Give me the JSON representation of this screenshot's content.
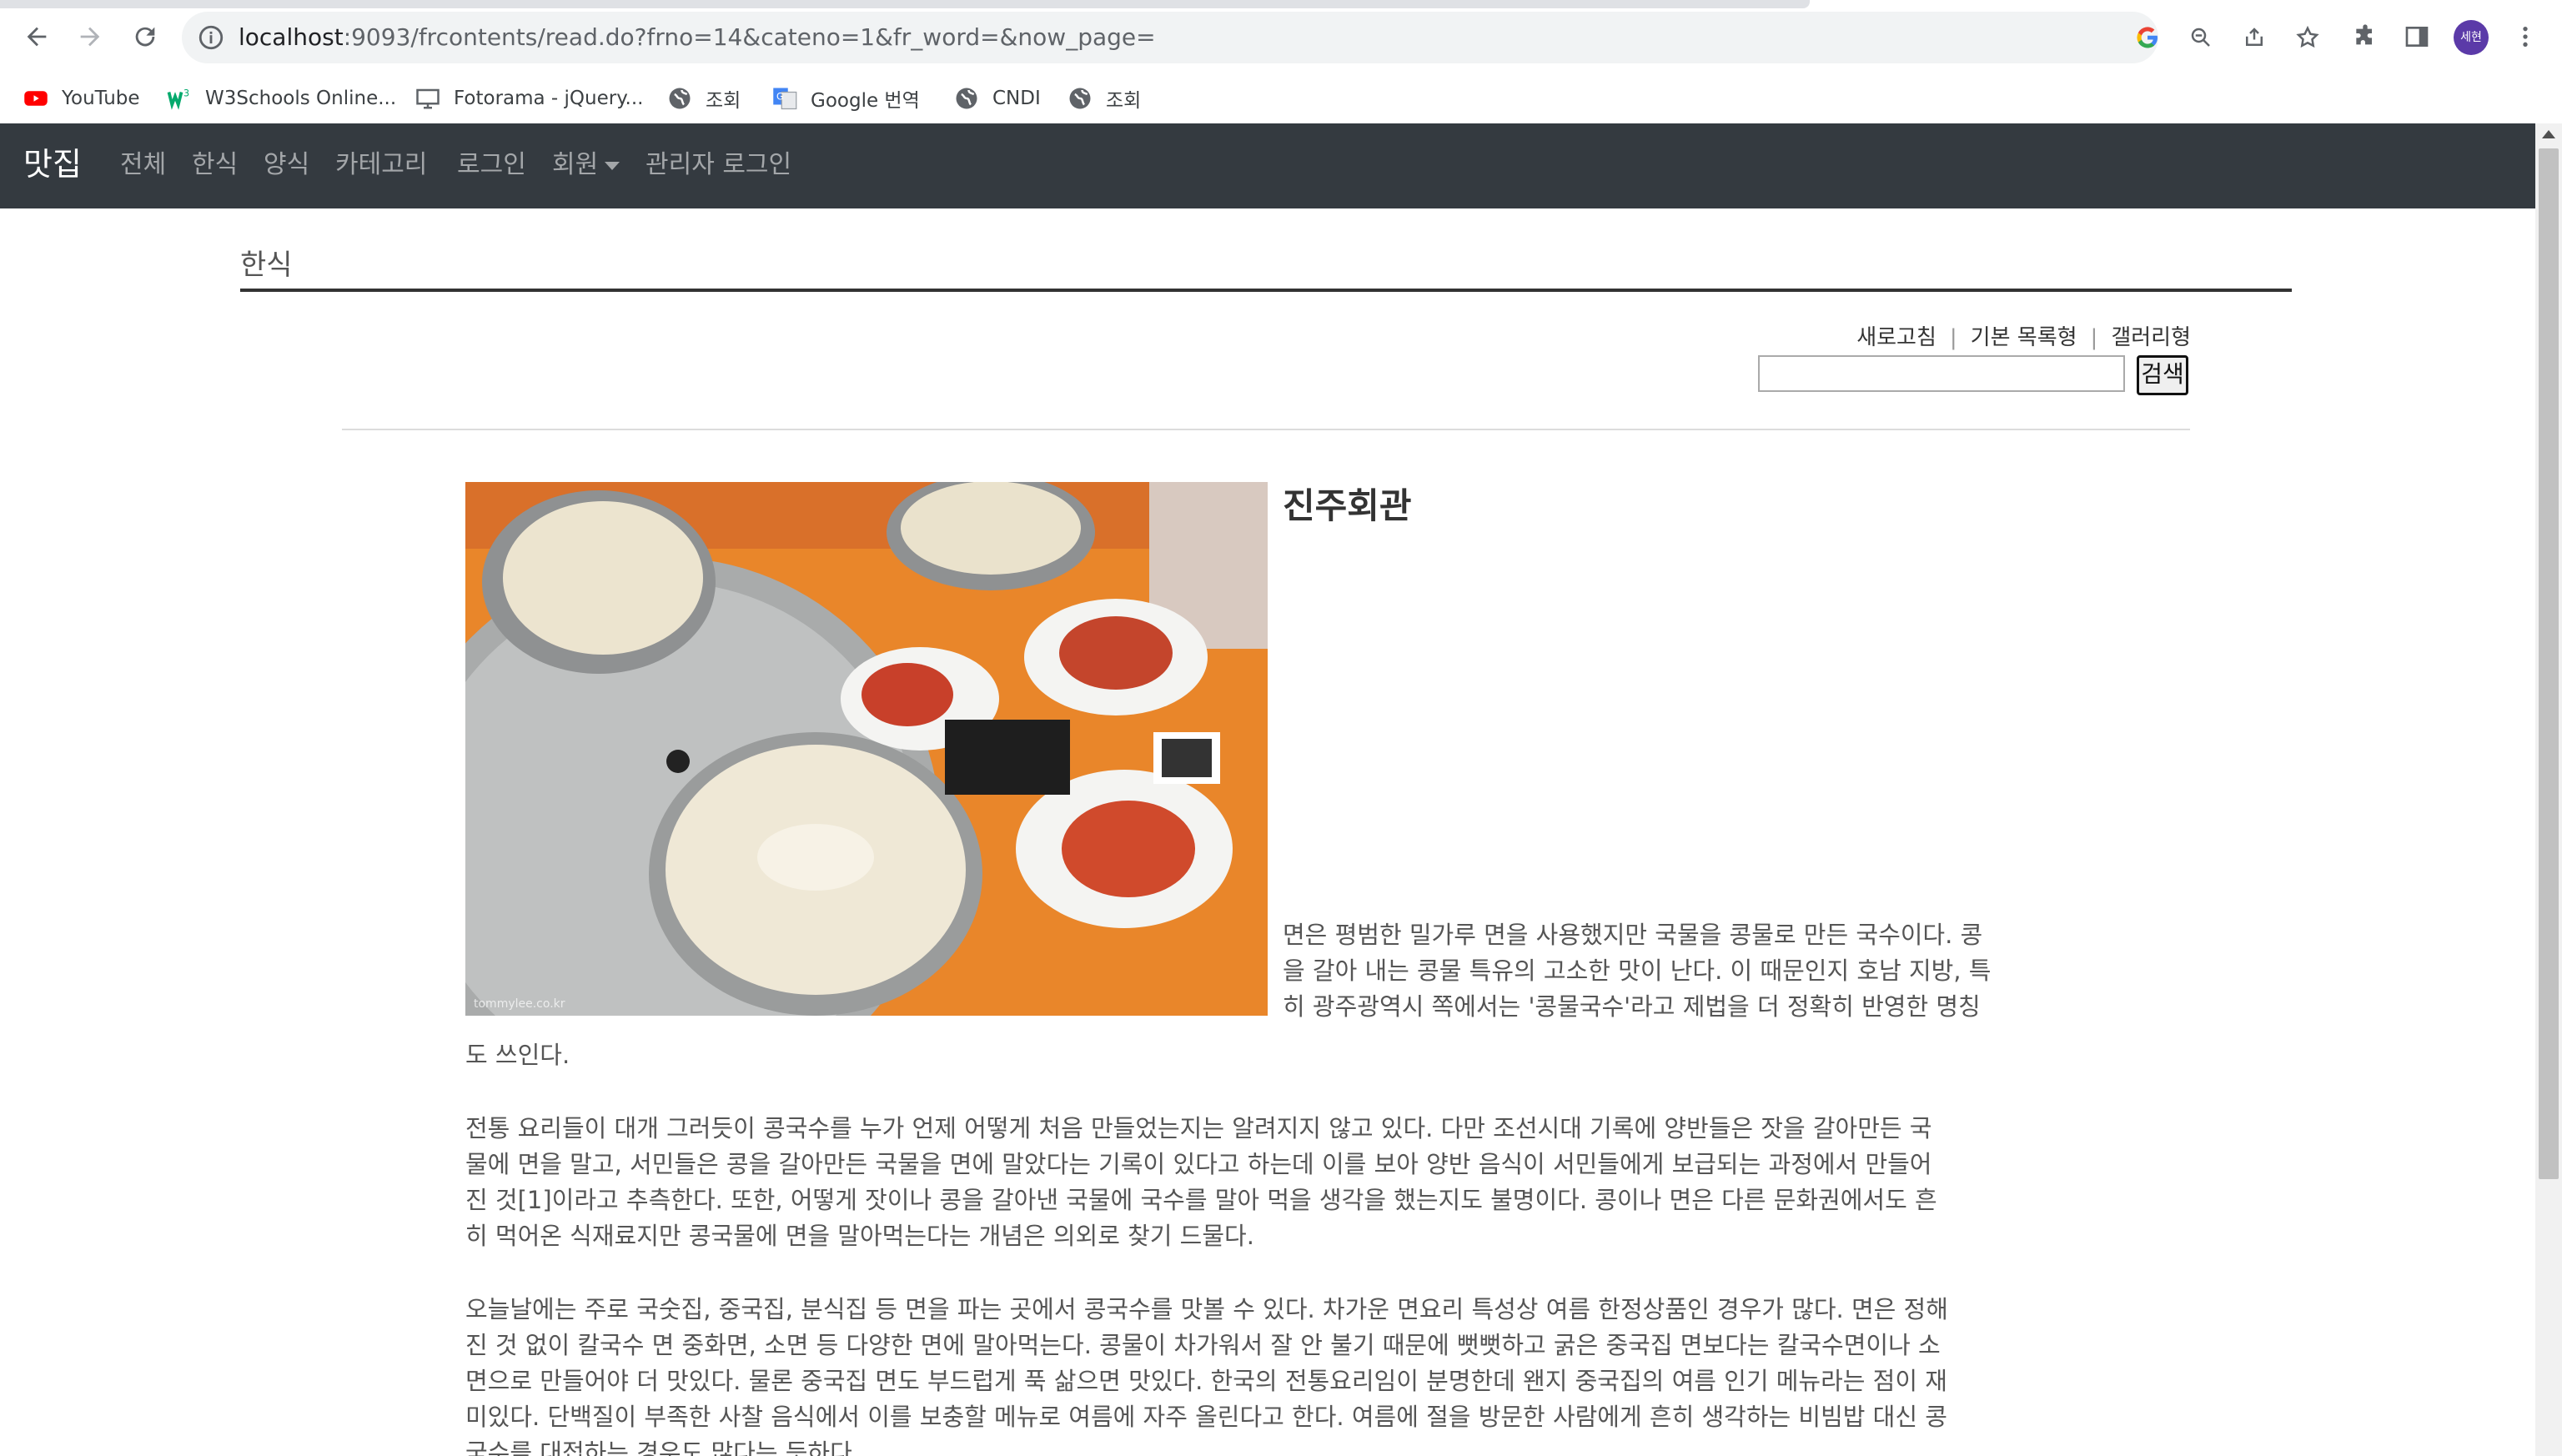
{
  "browser": {
    "url_host": "localhost",
    "url_rest": ":9093/frcontents/read.do?frno=14&cateno=1&fr_word=&now_page=",
    "profile_label": "세현"
  },
  "bookmarks": [
    {
      "label": "YouTube",
      "icon": "youtube-icon"
    },
    {
      "label": "W3Schools Online...",
      "icon": "w3schools-icon"
    },
    {
      "label": "Fotorama - jQuery...",
      "icon": "monitor-icon"
    },
    {
      "label": "조회",
      "icon": "globe-icon"
    },
    {
      "label": "Google 번역",
      "icon": "google-translate-icon"
    },
    {
      "label": "CNDI",
      "icon": "globe-icon"
    },
    {
      "label": "조회",
      "icon": "globe-icon"
    }
  ],
  "navbar": {
    "brand": "맛집",
    "links": [
      "전체",
      "한식",
      "양식",
      "카테고리",
      "로그인",
      "회원",
      "관리자 로그인"
    ]
  },
  "page": {
    "section_title": "한식",
    "links": [
      "새로고침",
      "기본 목록형",
      "갤러리형"
    ],
    "search_button": "검색",
    "search_value": "",
    "photo_credit": "tommylee.co.kr",
    "restaurant_name": "진주회관",
    "para1_lines": [
      "면은 평범한 밀가루 면을 사용했지만 국물을 콩물로 만든 국수이다. 콩",
      "을 갈아 내는 콩물 특유의 고소한 맛이 난다. 이 때문인지 호남 지방, 특",
      "히 광주광역시 쪽에서는 '콩물국수'라고 제법을 더 정확히 반영한 명칭"
    ],
    "para1_tail": "도 쓰인다.",
    "para2_lines": [
      "전통 요리들이 대개 그러듯이 콩국수를 누가 언제 어떻게 처음 만들었는지는 알려지지 않고 있다. 다만 조선시대 기록에 양반들은 잣을 갈아만든 국",
      "물에 면을 말고, 서민들은 콩을 갈아만든 국물을 면에 말았다는 기록이 있다고 하는데 이를 보아 양반 음식이 서민들에게 보급되는 과정에서 만들어",
      "진 것[1]이라고 추측한다. 또한, 어떻게 잣이나 콩을 갈아낸 국물에 국수를 말아 먹을 생각을 했는지도 불명이다. 콩이나 면은 다른 문화권에서도 흔",
      "히 먹어온 식재료지만 콩국물에 면을 말아먹는다는 개념은 의외로 찾기 드물다."
    ],
    "para3_lines": [
      "오늘날에는 주로 국숫집, 중국집, 분식집 등 면을 파는 곳에서 콩국수를 맛볼 수 있다. 차가운 면요리 특성상 여름 한정상품인 경우가 많다. 면은 정해",
      "진 것 없이 칼국수 면 중화면, 소면 등 다양한 면에 말아먹는다. 콩물이 차가워서 잘 안 불기 때문에 뻣뻣하고 굵은 중국집 면보다는 칼국수면이나 소",
      "면으로 만들어야 더 맛있다. 물론 중국집 면도 부드럽게 푹 삶으면 맛있다. 한국의 전통요리임이 분명한데 왠지 중국집의 여름 인기 메뉴라는 점이 재",
      "미있다. 단백질이 부족한 사찰 음식에서 이를 보충할 메뉴로 여름에 자주 올린다고 한다. 여름에 절을 방문한 사람에게 흔히 생각하는 비빔밥 대신 콩",
      "국수를 대접하는 경우도 많다는 듯하다."
    ]
  }
}
